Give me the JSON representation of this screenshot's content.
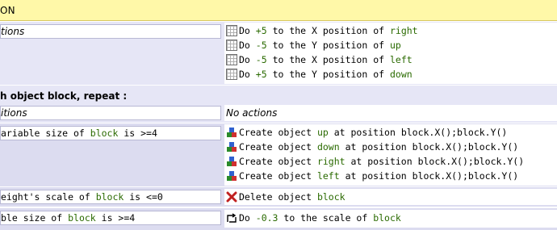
{
  "header": {
    "title": "ON"
  },
  "event1": {
    "condition": "tions",
    "actions": [
      {
        "pre": "Do ",
        "num": "+5",
        "mid": " to the X position of ",
        "obj": "right"
      },
      {
        "pre": "Do ",
        "num": "-5",
        "mid": " to the Y position of ",
        "obj": "up"
      },
      {
        "pre": "Do ",
        "num": "-5",
        "mid": " to the X position of ",
        "obj": "left"
      },
      {
        "pre": "Do ",
        "num": "+5",
        "mid": " to the Y position of ",
        "obj": "down"
      }
    ],
    "action_icon": "grid-position-icon"
  },
  "repeat": {
    "title": "h object block, repeat :",
    "condition": "itions",
    "actions_empty": "No actions"
  },
  "sub1": {
    "condition_pre": "ariable size of ",
    "condition_obj": "block",
    "condition_post": " is >=4",
    "actions": [
      {
        "pre": "Create object ",
        "obj": "up",
        "mid": " at position ",
        "pos": "block.X();block.Y()"
      },
      {
        "pre": "Create object ",
        "obj": "down",
        "mid": " at position ",
        "pos": "block.X();block.Y()"
      },
      {
        "pre": "Create object ",
        "obj": "right",
        "mid": " at position ",
        "pos": "block.X();block.Y()"
      },
      {
        "pre": "Create object ",
        "obj": "left",
        "mid": " at position ",
        "pos": "block.X();block.Y()"
      }
    ],
    "action_icon": "create-object-icon"
  },
  "sub2": {
    "condition_pre": "eight's scale of ",
    "condition_obj": "block",
    "condition_post": " is <=0",
    "action_pre": "Delete object ",
    "action_obj": "block",
    "action_icon": "delete-x-icon"
  },
  "sub3": {
    "condition_pre": "ble size of ",
    "condition_obj": "block",
    "condition_post": " is >=4",
    "action_pre": "Do ",
    "action_num": "-0.3",
    "action_mid": " to the scale of ",
    "action_obj": "block",
    "action_icon": "scale-arrow-icon"
  }
}
